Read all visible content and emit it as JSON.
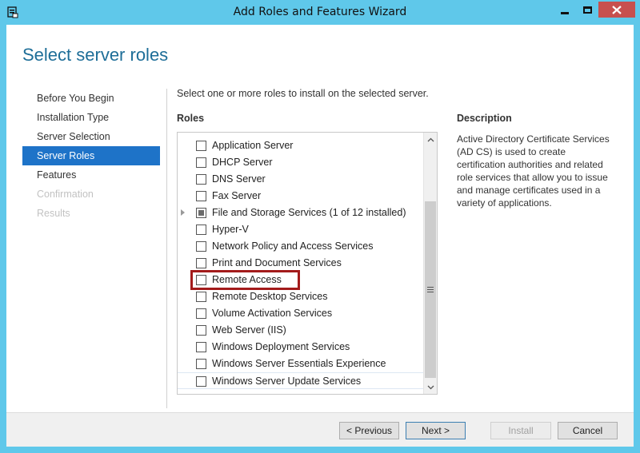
{
  "window": {
    "title": "Add Roles and Features Wizard",
    "icon": "server-manager-icon"
  },
  "page": {
    "title": "Select server roles"
  },
  "nav": {
    "items": [
      {
        "label": "Before You Begin",
        "state": "normal"
      },
      {
        "label": "Installation Type",
        "state": "normal"
      },
      {
        "label": "Server Selection",
        "state": "normal"
      },
      {
        "label": "Server Roles",
        "state": "active"
      },
      {
        "label": "Features",
        "state": "normal"
      },
      {
        "label": "Confirmation",
        "state": "disabled"
      },
      {
        "label": "Results",
        "state": "disabled"
      }
    ]
  },
  "main": {
    "instruction": "Select one or more roles to install on the selected server.",
    "roles_header": "Roles",
    "roles": [
      {
        "label": "Application Server",
        "checked": false
      },
      {
        "label": "DHCP Server",
        "checked": false
      },
      {
        "label": "DNS Server",
        "checked": false
      },
      {
        "label": "Fax Server",
        "checked": false
      },
      {
        "label": "File and Storage Services (1 of 12 installed)",
        "checked": "partial",
        "expandable": true
      },
      {
        "label": "Hyper-V",
        "checked": false
      },
      {
        "label": "Network Policy and Access Services",
        "checked": false
      },
      {
        "label": "Print and Document Services",
        "checked": false
      },
      {
        "label": "Remote Access",
        "checked": false,
        "highlighted": true
      },
      {
        "label": "Remote Desktop Services",
        "checked": false
      },
      {
        "label": "Volume Activation Services",
        "checked": false
      },
      {
        "label": "Web Server (IIS)",
        "checked": false
      },
      {
        "label": "Windows Deployment Services",
        "checked": false
      },
      {
        "label": "Windows Server Essentials Experience",
        "checked": false
      },
      {
        "label": "Windows Server Update Services",
        "checked": false,
        "selected": true
      }
    ]
  },
  "description": {
    "header": "Description",
    "text": "Active Directory Certificate Services (AD CS) is used to create certification authorities and related role services that allow you to issue and manage certificates used in a variety of applications."
  },
  "footer": {
    "previous": "< Previous",
    "next": "Next >",
    "install": "Install",
    "cancel": "Cancel"
  },
  "colors": {
    "titlebar": "#5fc8ea",
    "accent": "#1e73c8",
    "page_title": "#1e6e98",
    "highlight_box": "#a31b1b",
    "close_button": "#c7504e"
  }
}
